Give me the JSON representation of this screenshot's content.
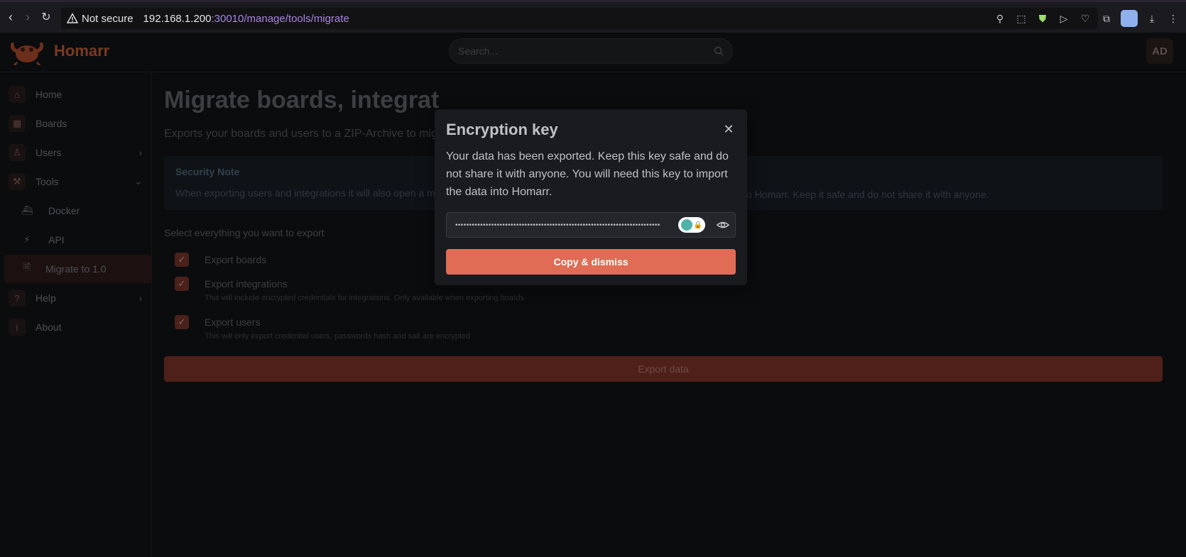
{
  "browser": {
    "not_secure_label": "Not secure",
    "url_host": "192.168.1.200",
    "url_path": ":30010/manage/tools/migrate"
  },
  "header": {
    "app_name": "Homarr",
    "search_placeholder": "Search...",
    "user_initials": "AD"
  },
  "sidebar": {
    "items": [
      {
        "label": "Home",
        "icon": "home-icon"
      },
      {
        "label": "Boards",
        "icon": "grid-icon"
      },
      {
        "label": "Users",
        "icon": "user-icon"
      },
      {
        "label": "Tools",
        "icon": "tools-icon"
      },
      {
        "label": "Docker",
        "icon": "docker-icon"
      },
      {
        "label": "API",
        "icon": "plug-icon"
      },
      {
        "label": "Migrate to 1.0",
        "icon": "file-icon"
      },
      {
        "label": "Help",
        "icon": "question-icon"
      },
      {
        "label": "About",
        "icon": "info-icon"
      }
    ]
  },
  "main": {
    "title": "Migrate boards, integrat",
    "subtitle": "Exports your boards and users to a ZIP-Archive to mig",
    "security_note": {
      "title": "Security Note",
      "text_left": "When exporting users and integrations it will also open a m",
      "text_right": "o Homarr. Keep it safe and do not share it with anyone."
    },
    "select_label": "Select everything you want to export",
    "options": [
      {
        "label": "Export boards",
        "description": "",
        "checked": true
      },
      {
        "label": "Export integrations",
        "description": "This will include encrypted credentials for integrations. Only available when exporting boards",
        "checked": true
      },
      {
        "label": "Export users",
        "description": "This will only export credential users, passwords hash and salt are encrypted",
        "checked": true
      }
    ],
    "export_label": "Export data"
  },
  "modal": {
    "title": "Encryption key",
    "body": "Your data has been exported. Keep this key safe and do not share it with anyone. You will need this key to import the data into Homarr.",
    "key_masked": "••••••••••••••••••••••••••••••••••••••••••••••••••••••••••••••••••••••••••",
    "copy_label": "Copy & dismiss"
  },
  "colors": {
    "accent": "#e06c55",
    "modal_bg": "#1a1b1e",
    "page_bg": "#0b0c0e"
  }
}
